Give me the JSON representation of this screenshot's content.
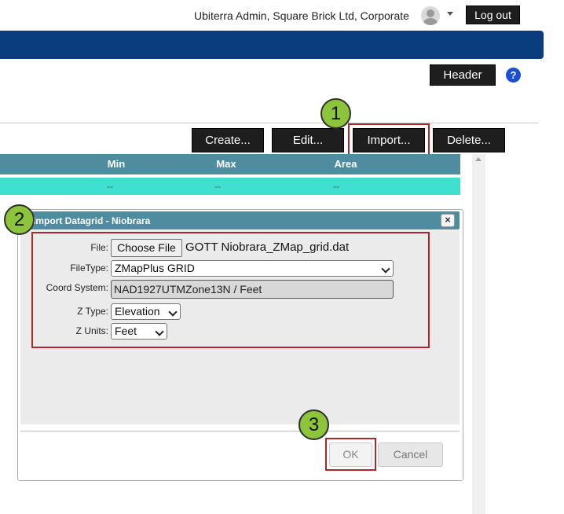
{
  "topbar": {
    "user_label": "Ubiterra Admin, Square Brick Ltd, Corporate",
    "logout_label": "Log out",
    "user_icon": "user-avatar-icon",
    "dropdown_icon": "caret-down-icon"
  },
  "nav": {
    "color": "#0a3d7e"
  },
  "header_button": {
    "label": "Header",
    "help_glyph": "?"
  },
  "actions": {
    "create": "Create...",
    "edit": "Edit...",
    "import": "Import...",
    "delete": "Delete..."
  },
  "table": {
    "columns": [
      "Min",
      "Max",
      "Area"
    ],
    "rows": [
      [
        "--",
        "--",
        "--"
      ]
    ],
    "header_color": "#4f8c9f",
    "row_color": "#40e0d0"
  },
  "dialog": {
    "title": "Import Datagrid - Niobrara",
    "close_glyph": "×",
    "file": {
      "label": "File:",
      "button": "Choose File",
      "value": "GOTT Niobrara_ZMap_grid.dat"
    },
    "filetype": {
      "label": "FileType:",
      "value": "ZMapPlus GRID"
    },
    "coord_system": {
      "label": "Coord System:",
      "value": "NAD1927UTMZone13N / Feet"
    },
    "ztype": {
      "label": "Z Type:",
      "value": "Elevation"
    },
    "zunits": {
      "label": "Z Units:",
      "value": "Feet"
    },
    "ok_label": "OK",
    "cancel_label": "Cancel"
  },
  "callouts": {
    "one": "1",
    "two": "2",
    "three": "3",
    "color": "#8cc43c",
    "highlight_color": "#b1262b"
  }
}
